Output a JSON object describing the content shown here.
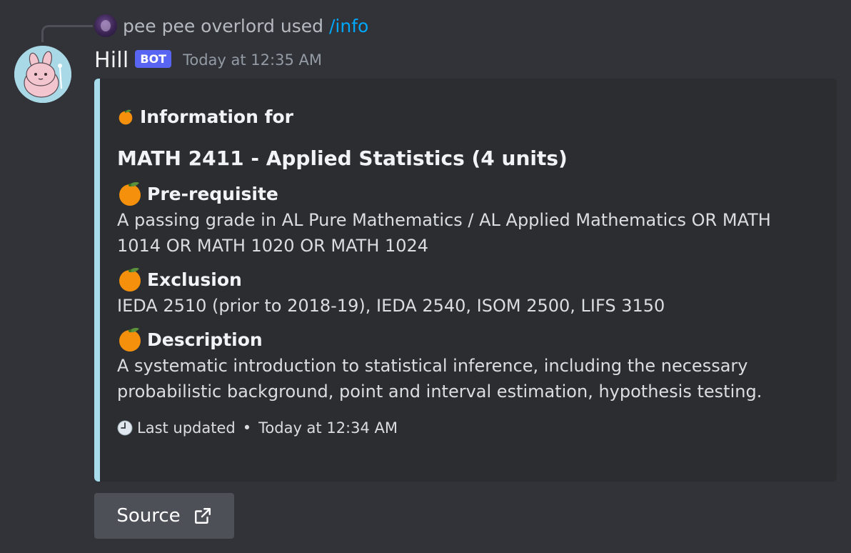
{
  "reply": {
    "username": "pee pee overlord",
    "used_text": "used",
    "command": "/info"
  },
  "message": {
    "author": "Hill",
    "badge": "BOT",
    "timestamp": "Today at 12:35 AM"
  },
  "embed": {
    "accent_color": "#a6dcec",
    "author_emoji": "orange-emoji",
    "author_text": "Information for",
    "title": "MATH 2411 - Applied Statistics (4 units)",
    "fields": [
      {
        "emoji": "orange-emoji",
        "name": "Pre-requisite",
        "value": "A passing grade in AL Pure Mathematics / AL Applied Mathematics OR MATH 1014 OR MATH 1020 OR MATH 1024"
      },
      {
        "emoji": "orange-emoji",
        "name": "Exclusion",
        "value": "IEDA 2510 (prior to 2018-19), IEDA 2540, ISOM 2500, LIFS 3150"
      },
      {
        "emoji": "orange-emoji",
        "name": "Description",
        "value": "A systematic introduction to statistical inference, including the necessary probabilistic background, point and interval estimation, hypothesis testing."
      }
    ],
    "footer": {
      "icon": "clock-icon",
      "text": "Last updated",
      "separator": "•",
      "timestamp": "Today at 12:34 AM"
    }
  },
  "source_button": {
    "label": "Source",
    "icon": "external-link-icon"
  },
  "colors": {
    "background": "#313338",
    "embed_background": "#2b2d31",
    "link": "#00a8fc",
    "bot_badge": "#5865f2",
    "button": "#4e5058"
  }
}
